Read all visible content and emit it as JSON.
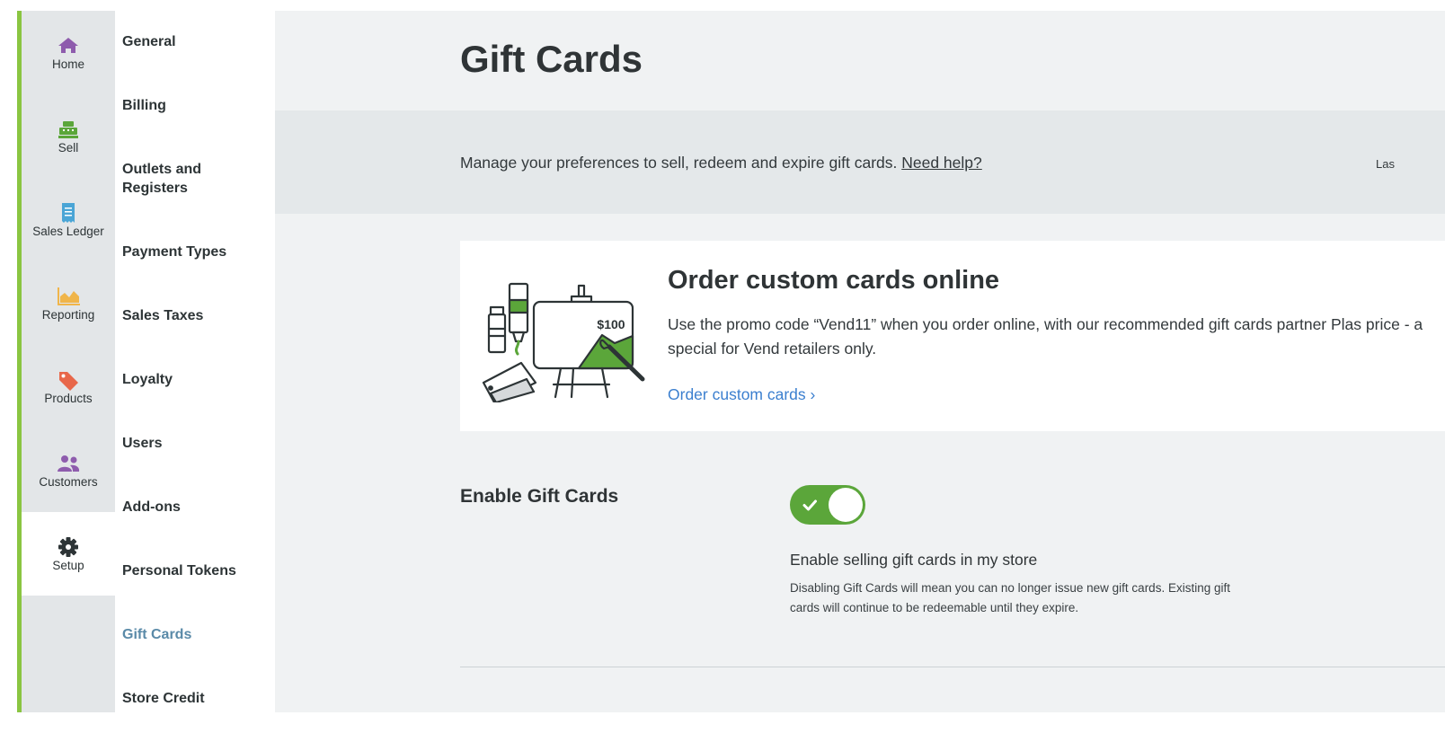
{
  "app_nav": [
    {
      "label": "Home",
      "icon": "home-icon",
      "color": "#8e5cad"
    },
    {
      "label": "Sell",
      "icon": "cash-register-icon",
      "color": "#5ba63a"
    },
    {
      "label": "Sales Ledger",
      "icon": "receipt-icon",
      "color": "#4aa5d6"
    },
    {
      "label": "Reporting",
      "icon": "area-chart-icon",
      "color": "#f0b54a"
    },
    {
      "label": "Products",
      "icon": "tags-icon",
      "color": "#e8674a"
    },
    {
      "label": "Customers",
      "icon": "users-icon",
      "color": "#8e5cad"
    },
    {
      "label": "Setup",
      "icon": "gear-icon",
      "color": "#2d3436",
      "active": true
    }
  ],
  "settings_nav": [
    {
      "label": "General"
    },
    {
      "label": "Billing"
    },
    {
      "label": "Outlets and Registers"
    },
    {
      "label": "Payment Types"
    },
    {
      "label": "Sales Taxes"
    },
    {
      "label": "Loyalty"
    },
    {
      "label": "Users"
    },
    {
      "label": "Add-ons"
    },
    {
      "label": "Personal Tokens"
    },
    {
      "label": "Gift Cards",
      "active": true
    },
    {
      "label": "Store Credit"
    }
  ],
  "page": {
    "title": "Gift Cards",
    "description": "Manage your preferences to sell, redeem and expire gift cards. ",
    "help_link": "Need help?",
    "last_updated": "Las"
  },
  "promo": {
    "title": "Order custom cards online",
    "body": "Use the promo code “Vend11” when you order online, with our recommended gift cards partner Plas price - a special for Vend retailers only.",
    "link": "Order custom cards ›",
    "illustration_price": "$100"
  },
  "enable_gift_cards": {
    "label": "Enable Gift Cards",
    "enabled": true,
    "caption": "Enable selling gift cards in my store",
    "help": "Disabling Gift Cards will mean you can no longer issue new gift cards. Existing gift cards will continue to be redeemable until they expire."
  },
  "colors": {
    "accent_green": "#8ac541",
    "toggle_on": "#5ba63a",
    "link_blue": "#3b7fcf",
    "active_subnav": "#5a8aa8"
  }
}
